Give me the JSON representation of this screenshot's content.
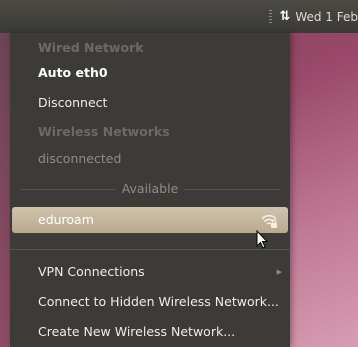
{
  "panel": {
    "network_icon": "network-up-down-arrows-icon",
    "clock": "Wed  1 Feb"
  },
  "menu": {
    "wired_header": "Wired Network",
    "wired_connection": "Auto eth0",
    "disconnect": "Disconnect",
    "wireless_header": "Wireless Networks",
    "wireless_status": "disconnected",
    "available_label": "Available",
    "network_name": "eduroam",
    "network_icon": "wifi-signal-locked-icon",
    "vpn": "VPN Connections",
    "hidden": "Connect to Hidden Wireless Network...",
    "create": "Create New Wireless Network..."
  },
  "colors": {
    "menu_bg": "#3c3b37",
    "selected_bg": "#c7bca3",
    "header_text": "#6c6a64"
  }
}
